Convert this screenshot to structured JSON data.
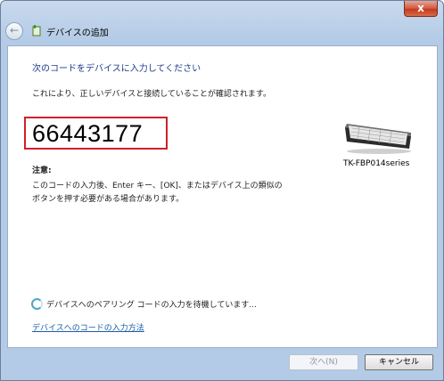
{
  "window": {
    "title": "デバイスの追加",
    "close_glyph": "x"
  },
  "content": {
    "instruction": "次のコードをデバイスに入力してください",
    "description": "これにより、正しいデバイスと接続していることが確認されます。",
    "pairing_code": "66443177",
    "note_heading": "注意:",
    "note_line1": "このコードの入力後、Enter キー、[OK]、またはデバイス上の類似の",
    "note_line2": "ボタンを押す必要がある場合があります。",
    "device_name": "TK-FBP014series",
    "waiting_status": "デバイスへのペアリング コードの入力を待機しています...",
    "help_link": "デバイスへのコードの入力方法"
  },
  "buttons": {
    "next": "次へ(N)",
    "cancel": "キャンセル"
  },
  "colors": {
    "code_border": "#d0202a",
    "instruction_text": "#1e3c8c",
    "link": "#1a5ea8"
  },
  "icons": {
    "back": "back-arrow-icon",
    "wizard": "add-device-wizard-icon",
    "device": "keyboard-icon",
    "spinner": "busy-spinner-icon"
  }
}
